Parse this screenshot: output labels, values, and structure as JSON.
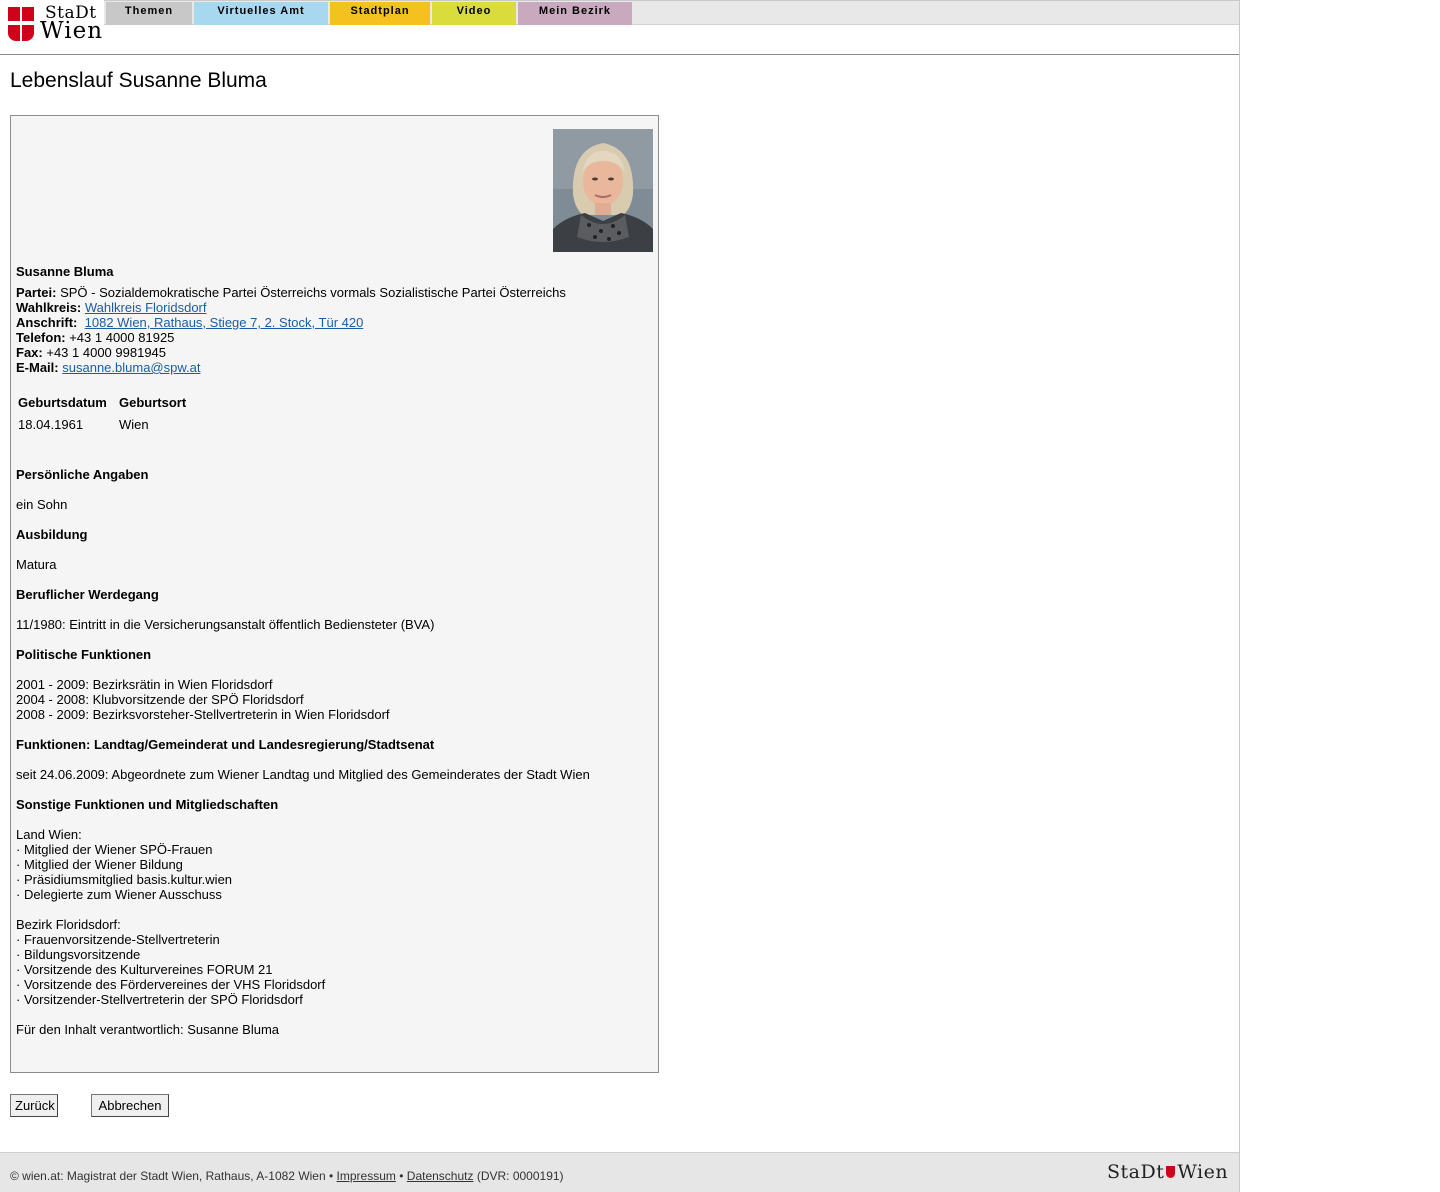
{
  "logo": {
    "line1": "StaDt",
    "line2": "Wien"
  },
  "nav": [
    {
      "label": "Themen",
      "color": "#c8c8c8"
    },
    {
      "label": "Virtuelles Amt",
      "color": "#a8d8f0"
    },
    {
      "label": "Stadtplan",
      "color": "#f5c11e"
    },
    {
      "label": "Video",
      "color": "#d9dc3a"
    },
    {
      "label": "Mein Bezirk",
      "color": "#c8a9be"
    }
  ],
  "page_title": "Lebenslauf Susanne Bluma",
  "profile": {
    "name": "Susanne Bluma",
    "partei_label": "Partei:",
    "partei": "SPÖ - Sozialdemokratische Partei Österreichs vormals Sozialistische Partei Österreichs",
    "wahlkreis_label": "Wahlkreis:",
    "wahlkreis": "Wahlkreis Floridsdorf",
    "anschrift_label": "Anschrift:",
    "anschrift": "1082 Wien, Rathaus, Stiege 7, 2. Stock, Tür 420",
    "telefon_label": "Telefon:",
    "telefon": "+43 1 4000 81925",
    "fax_label": "Fax:",
    "fax": "+43 1 4000 9981945",
    "email_label": "E-Mail:",
    "email": "susanne.bluma@spw.at",
    "birth_table": {
      "headers": [
        "Geburtsdatum",
        "Geburtsort"
      ],
      "values": [
        "18.04.1961",
        "Wien"
      ]
    },
    "sections": [
      {
        "heading": "Persönliche Angaben",
        "lines": [
          "ein Sohn"
        ]
      },
      {
        "heading": "Ausbildung",
        "lines": [
          "Matura"
        ]
      },
      {
        "heading": "Beruflicher Werdegang",
        "lines": [
          "11/1980: Eintritt in die Versicherungsanstalt öffentlich Bediensteter (BVA)"
        ]
      },
      {
        "heading": "Politische Funktionen",
        "lines": [
          "2001 - 2009: Bezirksrätin in Wien Floridsdorf",
          "2004 - 2008: Klubvorsitzende der SPÖ Floridsdorf",
          "2008 - 2009: Bezirksvorsteher-Stellvertreterin in Wien Floridsdorf"
        ]
      },
      {
        "heading": "Funktionen: Landtag/Gemeinderat und Landesregierung/Stadtsenat",
        "lines": [
          "seit 24.06.2009: Abgeordnete zum Wiener Landtag und Mitglied des Gemeinderates der Stadt Wien"
        ]
      },
      {
        "heading": "Sonstige Funktionen und Mitgliedschaften",
        "lines": [
          "Land Wien:",
          "· Mitglied der Wiener SPÖ-Frauen",
          "· Mitglied der Wiener Bildung",
          "· Präsidiumsmitglied basis.kultur.wien",
          "· Delegierte zum Wiener Ausschuss",
          "",
          "Bezirk Floridsdorf:",
          "· Frauenvorsitzende-Stellvertreterin",
          "· Bildungsvorsitzende",
          "· Vorsitzende des Kulturvereines FORUM 21",
          "· Vorsitzende des Fördervereines der VHS Floridsdorf",
          "· Vorsitzender-Stellvertreterin der SPÖ Floridsdorf"
        ]
      }
    ],
    "responsible": "Für den Inhalt verantwortlich: Susanne Bluma"
  },
  "buttons": {
    "back": "Zurück",
    "cancel": "Abbrechen"
  },
  "footer": {
    "copyright": "© wien.at: Magistrat der Stadt Wien, Rathaus, A-1082 Wien •",
    "impressum": "Impressum",
    "sep": "•",
    "datenschutz": "Datenschutz",
    "dvr": "(DVR: 0000191)",
    "logo_left": "StaDt",
    "logo_right": "Wien"
  }
}
